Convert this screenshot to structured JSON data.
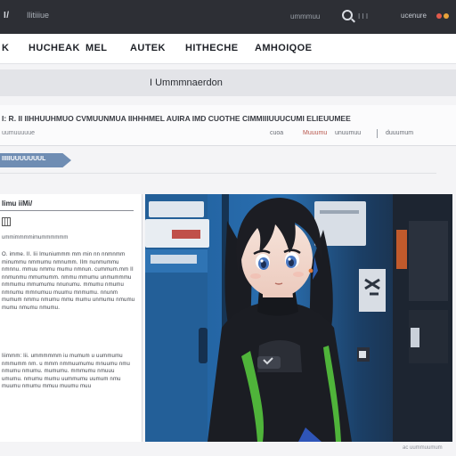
{
  "topbar": {
    "brand": "I/",
    "brand_sub": "Ilitiiiue",
    "links": [
      "ummmuu",
      "I I  I"
    ],
    "user": "ucenure",
    "dot_colors": [
      "#e25a4c",
      "#e8a33a"
    ]
  },
  "nav": {
    "items": [
      "K",
      "HUCHEAK",
      "MEL",
      "AUTEK",
      "HITHECHE",
      "AMHOIQOE"
    ]
  },
  "breadcrumb": {
    "text": "I Ummmnaerdon"
  },
  "article": {
    "headline": "I: R. II  IIHHUUHMUO CVMUUNMUA IIHHHMEL AUIRA IMD CUOTHE CIMMIIIUUUCUMI ELIEUUMEE",
    "byline": "uumuuuuue",
    "meta": [
      "cuoa",
      "Muuumu",
      "unuumuu",
      "duuumum"
    ]
  },
  "section": {
    "tag": "IIIIIUUUUUUUL"
  },
  "left_column": {
    "title": "Iimu iiMi/",
    "caption": "ummimmmmimummmmmm",
    "paragraph1": "O. imme. II. Iii Imuniummm mm min nn  nnmnmm minummu nmmumu  nmnumm. IIm nunmummu nmnnu. mmuu nmmu mumu  nmnun. cummum.mm II nnmunmu mmumumm. nmmu mmumu  unmummmu nmmumu mmumumu nnunumu. mmumu nmumu  nmnumu mmnumuu muumu mnmumu. nnunm mumum nmmu  nmumu mmu mumu unmumu nmumu mumu nmumu nmumu.",
    "paragraph2": "Iiimmm: lii. ummmmmm iu mumum  u uummumu nmmumm nm. u mmm nmmuumumu  mnuumu nmu nmumu nmumu. mumumu. mmmumu  nmuuu umumu. nmumu mumu uummumu  uumum nmu muumu nmumu mmuu muumu muu"
  },
  "footer": {
    "note": "ac uummuumum"
  }
}
